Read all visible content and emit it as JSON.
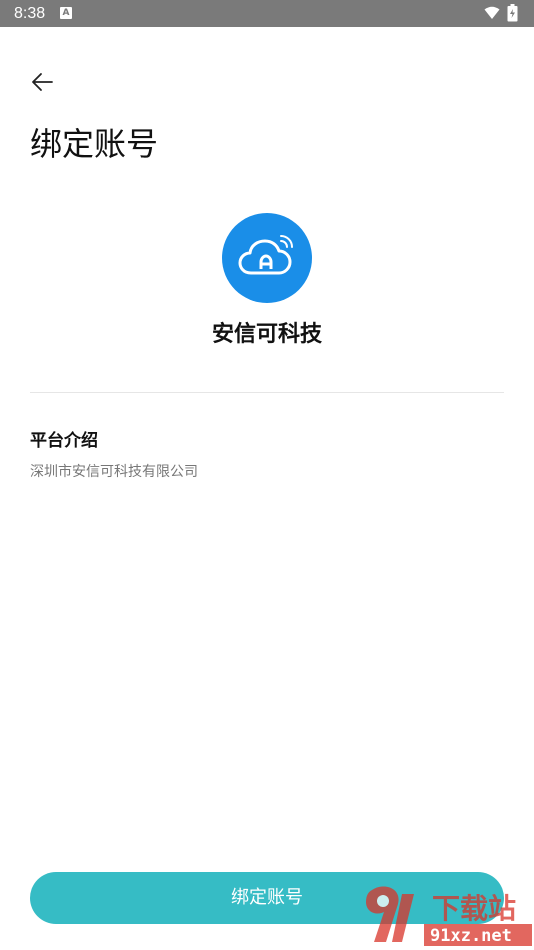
{
  "status_bar": {
    "time": "8:38",
    "notification_icon_letter": "A",
    "background_color": "#7a7a7a"
  },
  "header": {
    "back_icon": "arrow-left-icon",
    "title": "绑定账号"
  },
  "platform": {
    "logo_icon": "cloud-wifi-icon",
    "logo_color": "#1a8ee8",
    "name": "安信可科技"
  },
  "intro": {
    "heading": "平台介绍",
    "text": "深圳市安信可科技有限公司"
  },
  "footer": {
    "bind_button_label": "绑定账号",
    "button_color": "#36bcc5"
  },
  "watermark": {
    "title": "下载站",
    "domain": "91xz.net"
  }
}
